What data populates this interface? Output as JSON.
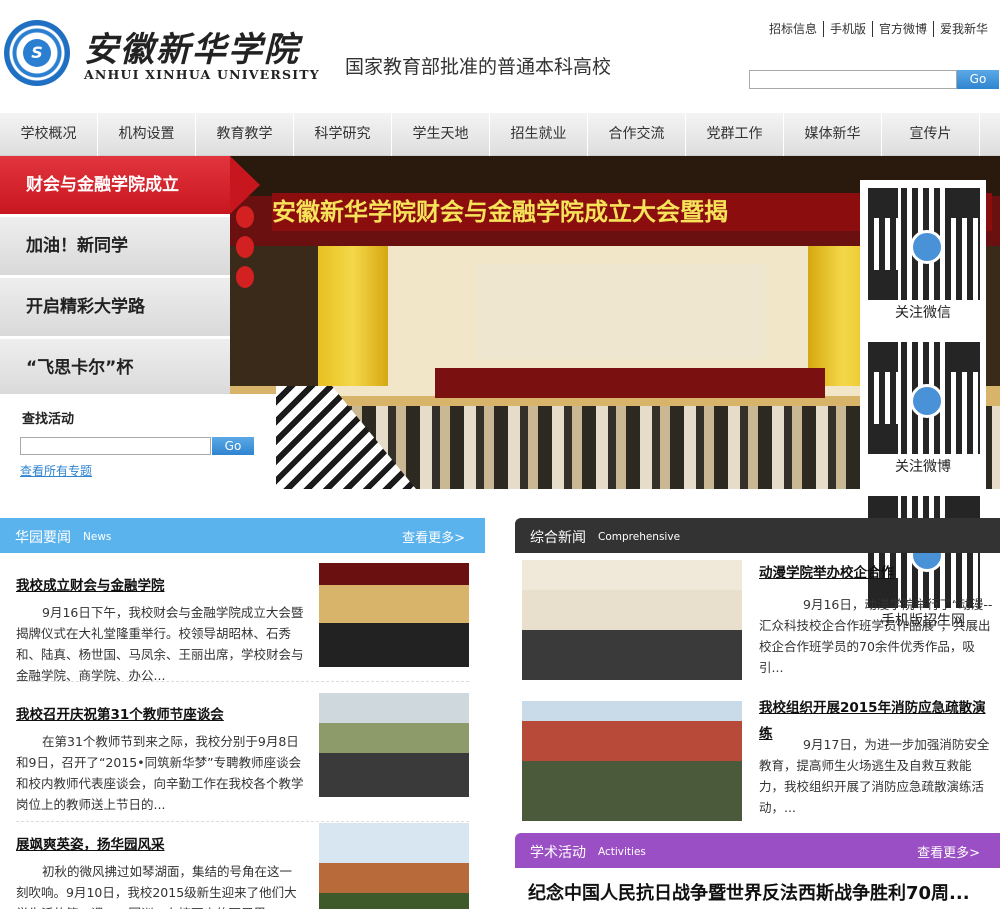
{
  "header": {
    "logo_cn": "安徽新华学院",
    "logo_en": "ANHUI XINHUA UNIVERSITY",
    "slogan": "国家教育部批准的普通本科高校",
    "top_links": [
      "招标信息",
      "手机版",
      "官方微博",
      "爱我新华"
    ],
    "search_button": "Go"
  },
  "nav": [
    "学校概况",
    "机构设置",
    "教育教学",
    "科学研究",
    "学生天地",
    "招生就业",
    "合作交流",
    "党群工作",
    "媒体新华",
    "宣传片"
  ],
  "banner": {
    "slides": [
      "财会与金融学院成立",
      "加油！新同学",
      "开启精彩大学路",
      "“飞思卡尔”杯"
    ],
    "photo_text": "安徽新华学院财会与金融学院成立大会暨揭",
    "find": {
      "title": "查找活动",
      "button": "Go",
      "view_all": "查看所有专题"
    }
  },
  "qr": [
    "关注微信",
    "关注微博",
    "手机版招生网"
  ],
  "campus_news": {
    "title_cn": "华园要闻",
    "title_en": "News",
    "more": "查看更多>",
    "items": [
      {
        "title": "我校成立财会与金融学院",
        "desc": "9月16日下午，我校财会与金融学院成立大会暨揭牌仪式在大礼堂隆重举行。校领导胡昭林、石秀和、陆真、杨世国、马凤余、王丽出席，学校财会与金融学院、商学院、办公..."
      },
      {
        "title": "我校召开庆祝第31个教师节座谈会",
        "desc": "在第31个教师节到来之际，我校分别于9月8日和9日，召开了“2015•同筑新华梦”专聘教师座谈会和校内教师代表座谈会，向辛勤工作在我校各个教学岗位上的教师送上节日的..."
      },
      {
        "title": "展飒爽英姿，扬华园风采",
        "desc": "初秋的微风拂过如琴湖面，集结的号角在这一刻吹响。9月10日，我校2015级新生迎来了他们大学生活的第一课——军训。在接下来的两周里，"
      }
    ]
  },
  "comprehensive_news": {
    "title_cn": "综合新闻",
    "title_en": "Comprehensive",
    "items": [
      {
        "title": "动漫学院举办校企合作",
        "desc": "9月16日，动漫学院举行了“动漫--汇众科技校企合作班学员作品展”，共展出校企合作班学员的70余件优秀作品，吸引..."
      },
      {
        "title": "我校组织开展2015年消防应急疏散演练",
        "desc": "9月17日，为进一步加强消防安全教育，提高师生火场逃生及自救互救能力，我校组织开展了消防应急疏散演练活动，..."
      }
    ]
  },
  "activities": {
    "title_cn": "学术活动",
    "title_en": "Activities",
    "more": "查看更多>",
    "headline": "纪念中国人民抗日战争暨世界反法西斯战争胜利70周..."
  }
}
